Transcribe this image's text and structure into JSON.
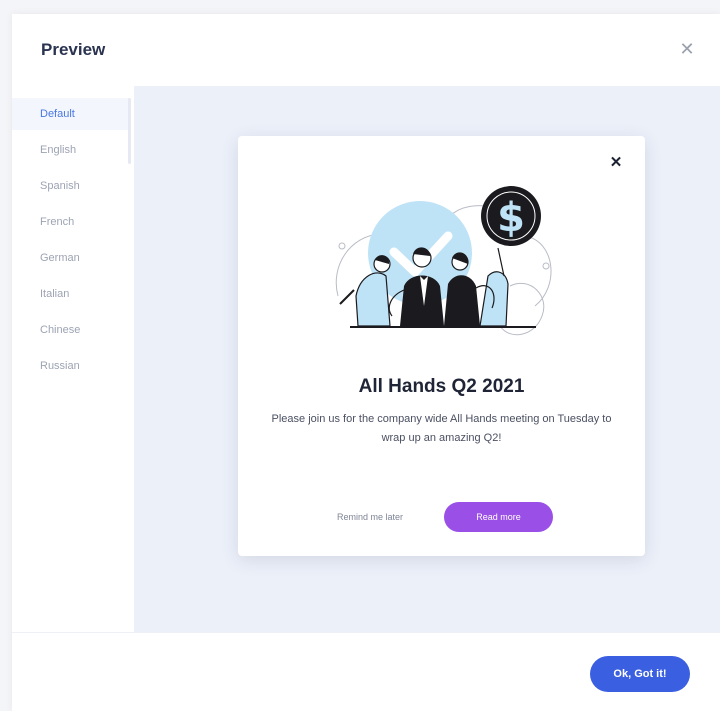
{
  "panel": {
    "title": "Preview",
    "close_icon": "close-icon"
  },
  "sidebar": {
    "items": [
      {
        "label": "Default",
        "active": true
      },
      {
        "label": "English",
        "active": false
      },
      {
        "label": "Spanish",
        "active": false
      },
      {
        "label": "French",
        "active": false
      },
      {
        "label": "German",
        "active": false
      },
      {
        "label": "Italian",
        "active": false
      },
      {
        "label": "Chinese",
        "active": false
      },
      {
        "label": "Russian",
        "active": false
      }
    ]
  },
  "modal": {
    "title": "All Hands Q2 2021",
    "body": "Please join us for the company wide All Hands meeting on Tuesday to wrap up an amazing Q2!",
    "secondary_label": "Remind me later",
    "primary_label": "Read more",
    "illustration": "team-celebration-illustration",
    "close_icon": "close-icon"
  },
  "footer": {
    "confirm_label": "Ok, Got it!"
  },
  "colors": {
    "accent_blue": "#3a5fe0",
    "primary_purple": "#9a4fe6",
    "content_bg": "#ecf0f9",
    "illustration_light_blue": "#bfe3f6"
  }
}
